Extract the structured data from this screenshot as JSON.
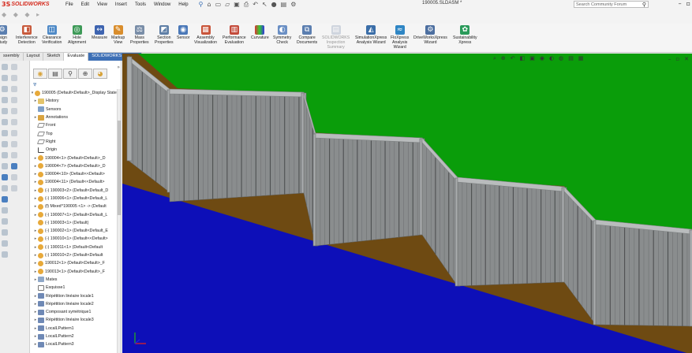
{
  "app": {
    "brand": "SOLIDWORKS",
    "document_title": "190005.SLDASM *"
  },
  "menu": [
    "File",
    "Edit",
    "View",
    "Insert",
    "Tools",
    "Window",
    "Help"
  ],
  "search": {
    "placeholder": "Search Community Forum"
  },
  "ribbon": {
    "left_partial": "esign\nStudy",
    "buttons": [
      {
        "label": "Interference\nDetection",
        "enabled": true
      },
      {
        "label": "Clearance\nVerification",
        "enabled": true
      },
      {
        "label": "Hole\nAlignment",
        "enabled": true
      },
      {
        "label": "Measure",
        "enabled": true
      },
      {
        "label": "Markup\nView",
        "enabled": true
      },
      {
        "label": "Mass\nProperties",
        "enabled": true
      },
      {
        "label": "Section\nProperties",
        "enabled": true
      },
      {
        "label": "Sensor",
        "enabled": true
      },
      {
        "label": "Assembly\nVisualization",
        "enabled": true
      },
      {
        "label": "Performance\nEvaluation",
        "enabled": true
      },
      {
        "label": "Curvature",
        "enabled": true
      },
      {
        "label": "Symmetry\nCheck",
        "enabled": true
      },
      {
        "label": "Compare\nDocuments",
        "enabled": true
      },
      {
        "label": "SOLIDWORKS\nInspection\nSummary",
        "enabled": false
      },
      {
        "label": "SimulationXpress\nAnalysis Wizard",
        "enabled": true
      },
      {
        "label": "FloXpress\nAnalysis\nWizard",
        "enabled": true
      },
      {
        "label": "DriveWorksXpress\nWizard",
        "enabled": true
      },
      {
        "label": "Sustainability\nXpress",
        "enabled": true
      }
    ]
  },
  "tabs": [
    {
      "label": "ssembly",
      "active": false
    },
    {
      "label": "Layout",
      "active": false
    },
    {
      "label": "Sketch",
      "active": false
    },
    {
      "label": "Evaluate",
      "active": true
    },
    {
      "label": "SOLIDWORKS Add-Ins",
      "active": false,
      "highlight": true
    }
  ],
  "feature_tree": {
    "root": "190005 (Default<Default>_Display State",
    "items": [
      {
        "label": "History",
        "icon": "folder-icon",
        "expander": "▸"
      },
      {
        "label": "Sensors",
        "icon": "sensor-icon",
        "expander": ""
      },
      {
        "label": "Annotations",
        "icon": "annotation-icon",
        "expander": "▸"
      },
      {
        "label": "Front",
        "icon": "plane-icon",
        "expander": ""
      },
      {
        "label": "Top",
        "icon": "plane-icon",
        "expander": ""
      },
      {
        "label": "Right",
        "icon": "plane-icon",
        "expander": ""
      },
      {
        "label": "Origin",
        "icon": "origin-icon",
        "expander": ""
      },
      {
        "label": "190004<1> (Default<Default>_D",
        "icon": "part-icon",
        "expander": "▸"
      },
      {
        "label": "190004<7> (Default<Default>_D",
        "icon": "part-icon",
        "expander": "▸"
      },
      {
        "label": "190004<10> (Default<<Default>",
        "icon": "part-icon",
        "expander": "▸"
      },
      {
        "label": "190004<11> (Default<<Default>",
        "icon": "part-icon",
        "expander": "▸"
      },
      {
        "label": "(-) 190003<2> (Default<Default_D",
        "icon": "part-icon",
        "expander": "▸"
      },
      {
        "label": "(-) 190006<1> (Default<Default_L",
        "icon": "part-icon",
        "expander": "▸"
      },
      {
        "label": "(f) Mixed^190005 <1> -> (Default",
        "icon": "part-icon",
        "expander": "▸"
      },
      {
        "label": "(-) 190007<1> (Default<Default_L",
        "icon": "part-icon",
        "expander": "▸"
      },
      {
        "label": "(-) 190003<1> (Default)",
        "icon": "part-icon",
        "expander": ""
      },
      {
        "label": "(-) 190002<1> (Default<Default_E",
        "icon": "part-icon",
        "expander": "▸"
      },
      {
        "label": "(-) 190010<1> (Default<<Default>",
        "icon": "part-icon",
        "expander": "▸"
      },
      {
        "label": "(-) 190011<1> (Default<Default",
        "icon": "part-icon",
        "expander": "▸"
      },
      {
        "label": "(-) 190010<2> (Default<Default",
        "icon": "part-icon",
        "expander": "▸"
      },
      {
        "label": "190012<1> (Default<Default>_F",
        "icon": "part-icon",
        "expander": "▸"
      },
      {
        "label": "190013<1> (Default<Default>_F",
        "icon": "part-icon",
        "expander": "▸"
      },
      {
        "label": "Mates",
        "icon": "mates-icon",
        "expander": "▸"
      },
      {
        "label": "Esquisse1",
        "icon": "sketch-icon",
        "expander": ""
      },
      {
        "label": "Répétition linéaire locale1",
        "icon": "pattern-icon",
        "expander": "▸"
      },
      {
        "label": "Répétition linéaire locale2",
        "icon": "pattern-icon",
        "expander": "▸"
      },
      {
        "label": "Composant symétrique1",
        "icon": "pattern-icon",
        "expander": "▸"
      },
      {
        "label": "Répétition linéaire locale3",
        "icon": "pattern-icon",
        "expander": "▸"
      },
      {
        "label": "LocalLPattern1",
        "icon": "pattern-icon",
        "expander": "▸"
      },
      {
        "label": "LocalLPattern2",
        "icon": "pattern-icon",
        "expander": "▸"
      },
      {
        "label": "LocalLPattern3",
        "icon": "pattern-icon",
        "expander": "▸"
      }
    ]
  },
  "colors": {
    "grass": "#0a9d0a",
    "water": "#0d0fb8",
    "soil": "#6e4a12",
    "fence_wood": "#8a8d8e",
    "fence_cap": "#b9bcbd",
    "brand_red": "#d52b1e"
  }
}
